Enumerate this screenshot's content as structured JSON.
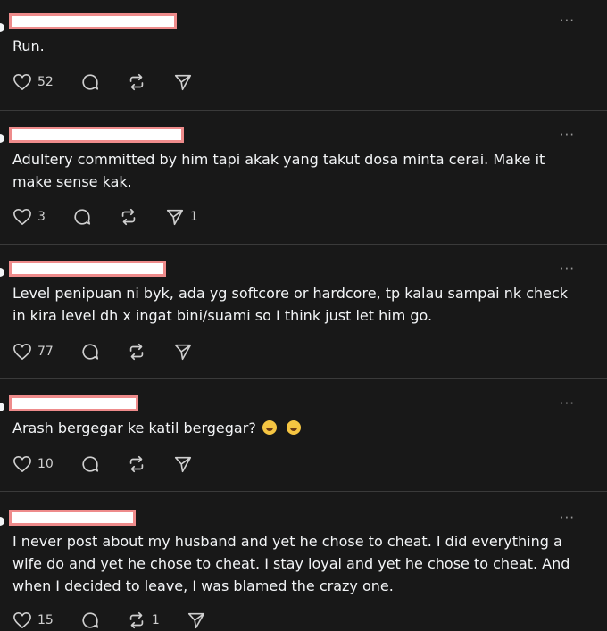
{
  "posts": [
    {
      "text": "Run.",
      "likes": "52",
      "reposts": "",
      "shares": "",
      "more": "···"
    },
    {
      "text": "Adultery committed by him tapi akak yang takut dosa minta cerai. Make it make sense kak.",
      "likes": "3",
      "reposts": "",
      "shares": "1",
      "more": "···"
    },
    {
      "text": "Level penipuan ni byk, ada yg softcore or hardcore, tp kalau sampai nk check in kira level dh x ingat bini/suami so I think just let him go.",
      "likes": "77",
      "reposts": "",
      "shares": "",
      "more": "···"
    },
    {
      "text": "Arash bergegar ke katil bergegar?",
      "emojis": [
        "laughing-emoji",
        "laughing-emoji"
      ],
      "likes": "10",
      "reposts": "",
      "shares": "",
      "more": "···"
    },
    {
      "text": "I never post about my husband and yet he chose to cheat. I did everything a wife do and yet he chose to cheat. I stay loyal and yet he chose to cheat. And when I decided to leave, I was blamed the crazy one.",
      "likes": "15",
      "reposts": "1",
      "shares": "",
      "more": "···"
    }
  ],
  "icons": {
    "like": "heart-icon",
    "reply": "comment-bubble-icon",
    "repost": "repost-icon",
    "share": "send-icon"
  },
  "colors": {
    "background": "#181818",
    "text": "#f3f5f7",
    "redaction_border": "#ee8b8b"
  }
}
